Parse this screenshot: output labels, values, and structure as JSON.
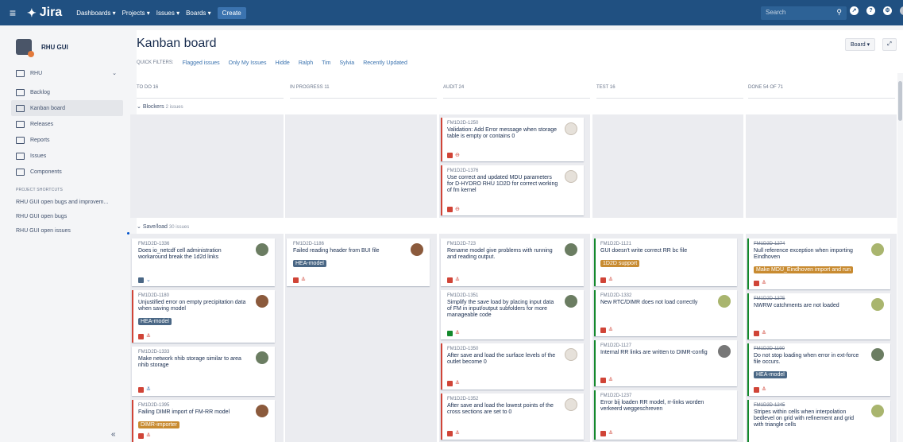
{
  "topbar": {
    "logo": "Jira",
    "nav": [
      "Dashboards ▾",
      "Projects ▾",
      "Issues ▾",
      "Boards ▾"
    ],
    "create": "Create",
    "search_placeholder": "Search",
    "colors": {
      "bg": "#205081",
      "accent": "#3b73af"
    }
  },
  "sidebar": {
    "project": "RHU GUI",
    "items": [
      {
        "label": "RHU",
        "icon": "board-switch-icon"
      },
      {
        "label": "Backlog",
        "icon": "backlog-icon"
      },
      {
        "label": "Kanban board",
        "icon": "kanban-icon",
        "active": true
      },
      {
        "label": "Releases",
        "icon": "releases-icon"
      },
      {
        "label": "Reports",
        "icon": "reports-icon"
      },
      {
        "label": "Issues",
        "icon": "issues-icon"
      },
      {
        "label": "Components",
        "icon": "components-icon"
      }
    ],
    "shortcuts_heading": "PROJECT SHORTCUTS",
    "shortcuts": [
      "RHU GUI open bugs and improvem...",
      "RHU GUI open bugs",
      "RHU GUI open issues"
    ]
  },
  "board": {
    "title": "Kanban board",
    "quick_filters_label": "QUICK FILTERS:",
    "filters": [
      "Flagged issues",
      "Only My Issues",
      "Hidde",
      "Ralph",
      "Tim",
      "Sylvia",
      "Recently Updated"
    ],
    "board_button": "Board ▾",
    "columns": [
      "TO DO 16",
      "IN PROGRESS 11",
      "AUDIT 24",
      "TEST 16",
      "DONE 54 OF 71"
    ],
    "swimlanes": [
      {
        "name": "Blockers",
        "count": "2 issues"
      },
      {
        "name": "Save/load",
        "count": "30 issues"
      }
    ]
  },
  "cards": {
    "a1": {
      "key": "FM1D2D-1250",
      "summary": "Validation: Add Error message when storage table is empty or contains 0"
    },
    "a2": {
      "key": "FM1D2D-1376",
      "summary": "Use correct and updated MDU parameters for D-HYDRO RHU 1D2D for correct working of fm kernel"
    },
    "t1": {
      "key": "FM1D2D-1336",
      "summary": "Does io_netcdf cell administration workaround break the 1d2d links"
    },
    "t2": {
      "key": "FM1D2D-1180",
      "summary": "Unjustified error on empty precipitation data when saving model",
      "epic": "HEA-model"
    },
    "t3": {
      "key": "FM1D2D-1333",
      "summary": "Make network nhib storage similar to area nhib storage"
    },
    "t4": {
      "key": "FM1D2D-1395",
      "summary": "Failing DIMR import of FM-RR model",
      "epic": "DIMR-importer"
    },
    "p1": {
      "key": "FM1D2D-1186",
      "summary": "Failed reading header from BUI file",
      "epic": "HEA-model"
    },
    "u1": {
      "key": "FM1D2D-723",
      "summary": "Rename model give problems with running and reading output."
    },
    "u2": {
      "key": "FM1D2D-1351",
      "summary": "Simplify the save load by placing input data of FM in input/output subfolders for more manageable code"
    },
    "u3": {
      "key": "FM1D2D-1350",
      "summary": "After save and load the surface levels of the outlet become 0"
    },
    "u4": {
      "key": "FM1D2D-1352",
      "summary": "After save and load the lowest points of the cross sections are set to 0"
    },
    "s1": {
      "key": "FM1D2D-1121",
      "summary": "GUI doesn't write correct RR bc file",
      "epic": "1D2D support"
    },
    "s2": {
      "key": "FM1D2D-1332",
      "summary": "New RTC/DIMR does not load correctly"
    },
    "s3": {
      "key": "FM1D2D-1127",
      "summary": "Internal RR links are written to DIMR-config"
    },
    "s4": {
      "key": "FM1D2D-1237",
      "summary": "Error bij loaden RR model, rr-links worden verkeerd weggeschreven"
    },
    "d1": {
      "key": "FM1D2D-1274",
      "summary": "Null reference exception when importing Eindhoven",
      "epic": "Make MDU_Eindhoven import and run"
    },
    "d2": {
      "key": "FM1D2D-1375",
      "summary": "NWRW catchments are not loaded"
    },
    "d3": {
      "key": "FM1D2D-1190",
      "summary": "Do not stop loading when error in ext-force file occurs.",
      "epic": "HEA-model"
    },
    "d4": {
      "key": "FM1D2D-1245",
      "summary": "Stripes within cells when interpolation bedlevel on grid with refinement and grid with triangle cells"
    }
  },
  "epic_colors": {
    "hea": "#4a6785",
    "dimr": "#c88b31",
    "support": "#c88b31",
    "mdu": "#c88b31"
  }
}
